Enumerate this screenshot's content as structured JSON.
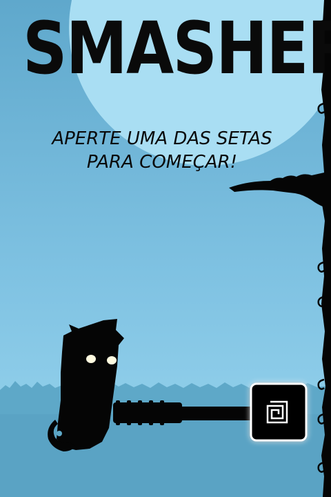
{
  "game": {
    "title": "SMASHER",
    "prompt_line1": "APERTE UMA DAS SETAS",
    "prompt_line2": "PARA COMEÇAR!"
  },
  "colors": {
    "sky": "#8fd0ea",
    "moon": "#a9def3",
    "ground": "#5ea8c8",
    "silhouette": "#050505",
    "hammer_glow": "#ffffff",
    "eyes": "#fffbe0"
  },
  "icons": {
    "hammer_emblem": "spiral-square-icon"
  }
}
